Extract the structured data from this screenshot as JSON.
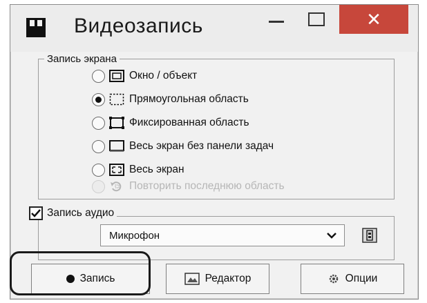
{
  "window": {
    "title": "Видеозапись",
    "close_glyph": "✕"
  },
  "screen_group": {
    "legend": "Запись экрана",
    "options": [
      {
        "label": "Окно / объект",
        "icon": "window-object-icon",
        "selected": false,
        "enabled": true
      },
      {
        "label": "Прямоугольная область",
        "icon": "dashed-rectangle-icon",
        "selected": true,
        "enabled": true
      },
      {
        "label": "Фиксированная область",
        "icon": "fixed-area-icon",
        "selected": false,
        "enabled": true
      },
      {
        "label": "Весь экран без панели задач",
        "icon": "screen-no-taskbar-icon",
        "selected": false,
        "enabled": true
      },
      {
        "label": "Весь экран",
        "icon": "fullscreen-icon",
        "selected": false,
        "enabled": true
      },
      {
        "label": "Повторить последнюю область",
        "icon": "repeat-area-icon",
        "selected": false,
        "enabled": false
      }
    ]
  },
  "audio_group": {
    "checkbox_label": "Запись аудио",
    "checked": true,
    "device_value": "Микрофон",
    "device_settings_icon": "audio-device-settings-icon"
  },
  "buttons": {
    "record": "Запись",
    "editor": "Редактор",
    "options": "Опции"
  }
}
